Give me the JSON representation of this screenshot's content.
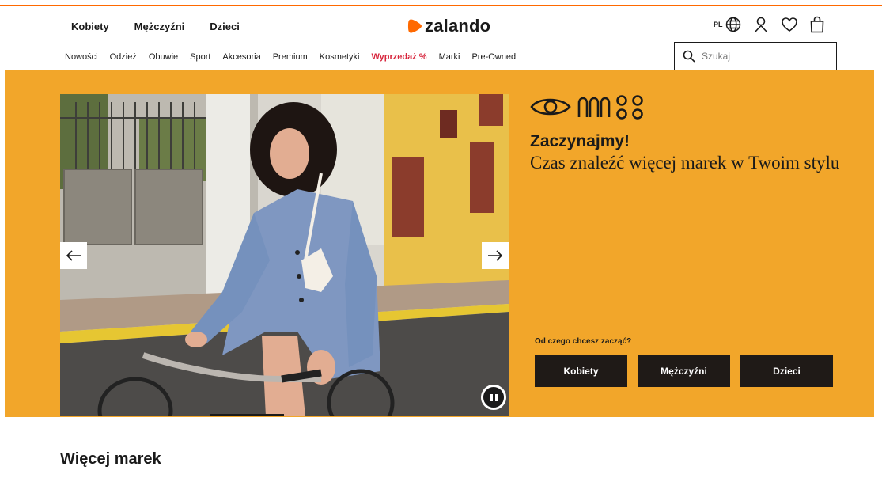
{
  "colors": {
    "brand_orange": "#ff6900",
    "hero_background": "#f2a62a",
    "button_dark": "#1f1a17",
    "sale_red": "#d7263d"
  },
  "header": {
    "gender_tabs": [
      "Kobiety",
      "Mężczyźni",
      "Dzieci"
    ],
    "logo_text": "zalando",
    "language": "PL",
    "icons": [
      "globe-icon",
      "account-icon",
      "wishlist-heart-icon",
      "shopping-bag-icon"
    ]
  },
  "catnav": {
    "items": [
      "Nowości",
      "Odzież",
      "Obuwie",
      "Sport",
      "Akcesoria",
      "Premium",
      "Kosmetyki",
      "Wyprzedaż %",
      "Marki",
      "Pre-Owned"
    ]
  },
  "search": {
    "placeholder": "Szukaj",
    "icon": "search-icon"
  },
  "hero": {
    "title": "Zaczynajmy!",
    "subtitle": "Czas znaleźć więcej marek w Twoim stylu",
    "question": "Od czego chcesz zacząć?",
    "buttons": [
      "Kobiety",
      "Mężczyźni",
      "Dzieci"
    ],
    "carousel_controls": [
      "arrow-left-icon",
      "arrow-right-icon",
      "pause-icon"
    ]
  },
  "section": {
    "title": "Więcej marek"
  }
}
